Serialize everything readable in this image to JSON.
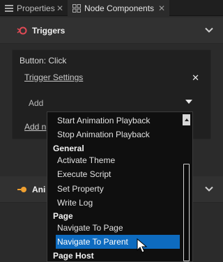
{
  "tabs": [
    {
      "label": "Properties",
      "icon": "list-icon",
      "active": false
    },
    {
      "label": "Node Components",
      "icon": "component-icon",
      "active": true
    }
  ],
  "tab_close_glyph": "✕",
  "triggers_section": {
    "title": "Triggers",
    "icon": "trigger-icon",
    "accent": "#e04a55"
  },
  "animations_section": {
    "title": "Ani",
    "icon": "animation-icon",
    "accent": "#f0a030"
  },
  "trigger_panel": {
    "title": "Button: Click",
    "settings_link": "Trigger Settings",
    "close_glyph": "✕",
    "add_label": "Add",
    "add_link": "Add n"
  },
  "dropdown": {
    "items": [
      {
        "kind": "item",
        "label": "Start Animation Playback"
      },
      {
        "kind": "item",
        "label": "Stop Animation Playback"
      },
      {
        "kind": "group",
        "label": "General"
      },
      {
        "kind": "item",
        "label": "Activate Theme"
      },
      {
        "kind": "item",
        "label": "Execute Script"
      },
      {
        "kind": "item",
        "label": "Set Property"
      },
      {
        "kind": "item",
        "label": "Write Log"
      },
      {
        "kind": "group",
        "label": "Page"
      },
      {
        "kind": "item",
        "label": "Navigate To Page"
      },
      {
        "kind": "item",
        "label": "Navigate To Parent",
        "selected": true
      },
      {
        "kind": "group",
        "label": "Page Host"
      }
    ],
    "selection_color": "#0e6bbf"
  }
}
